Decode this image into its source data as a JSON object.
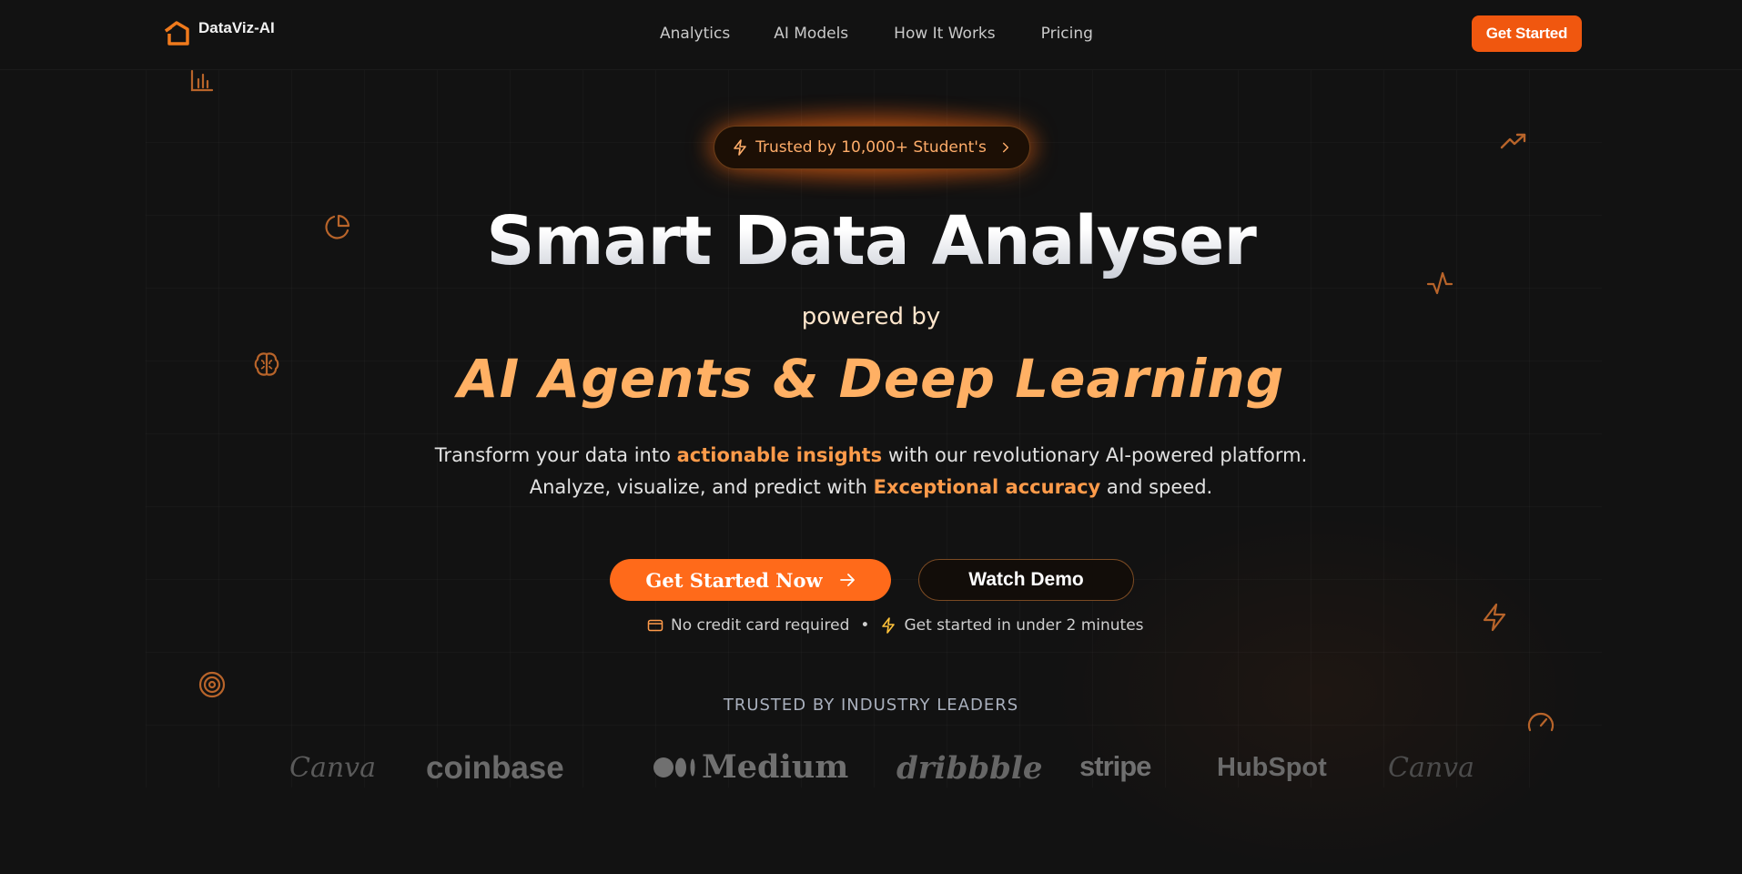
{
  "nav": {
    "brand": "DataViz-AI",
    "links": [
      "Analytics",
      "AI Models",
      "How It Works",
      "Pricing"
    ],
    "cta": "Get Started"
  },
  "badge": {
    "text": "Trusted by 10,000+ Student's"
  },
  "hero": {
    "title": "Smart Data Analyser",
    "powered": "powered by",
    "tagline": "AI Agents & Deep Learning",
    "desc1_a": "Transform your data into ",
    "desc1_hl": "actionable insights",
    "desc1_b": " with our revolutionary AI-powered platform.",
    "desc2_a": "Analyze, visualize, and predict with ",
    "desc2_hl": "Exceptional accuracy",
    "desc2_b": " and speed."
  },
  "cta": {
    "primary": "Get Started Now",
    "secondary": "Watch Demo",
    "note1": "No credit card required",
    "separator": "•",
    "note2": "Get started in under 2 minutes"
  },
  "trusted": {
    "heading": "TRUSTED BY INDUSTRY LEADERS",
    "brands": [
      "Canva",
      "coinbase",
      "Medium",
      "dribbble",
      "stripe",
      "HubSpot",
      "Canva"
    ]
  },
  "colors": {
    "accent": "#f0570f",
    "highlight": "#ff9b4a",
    "background": "#121212"
  },
  "icons": {
    "floating": [
      "bar-chart-icon",
      "pie-chart-icon",
      "brain-icon",
      "target-icon",
      "trending-up-icon",
      "activity-icon",
      "zap-icon",
      "gauge-icon"
    ]
  }
}
